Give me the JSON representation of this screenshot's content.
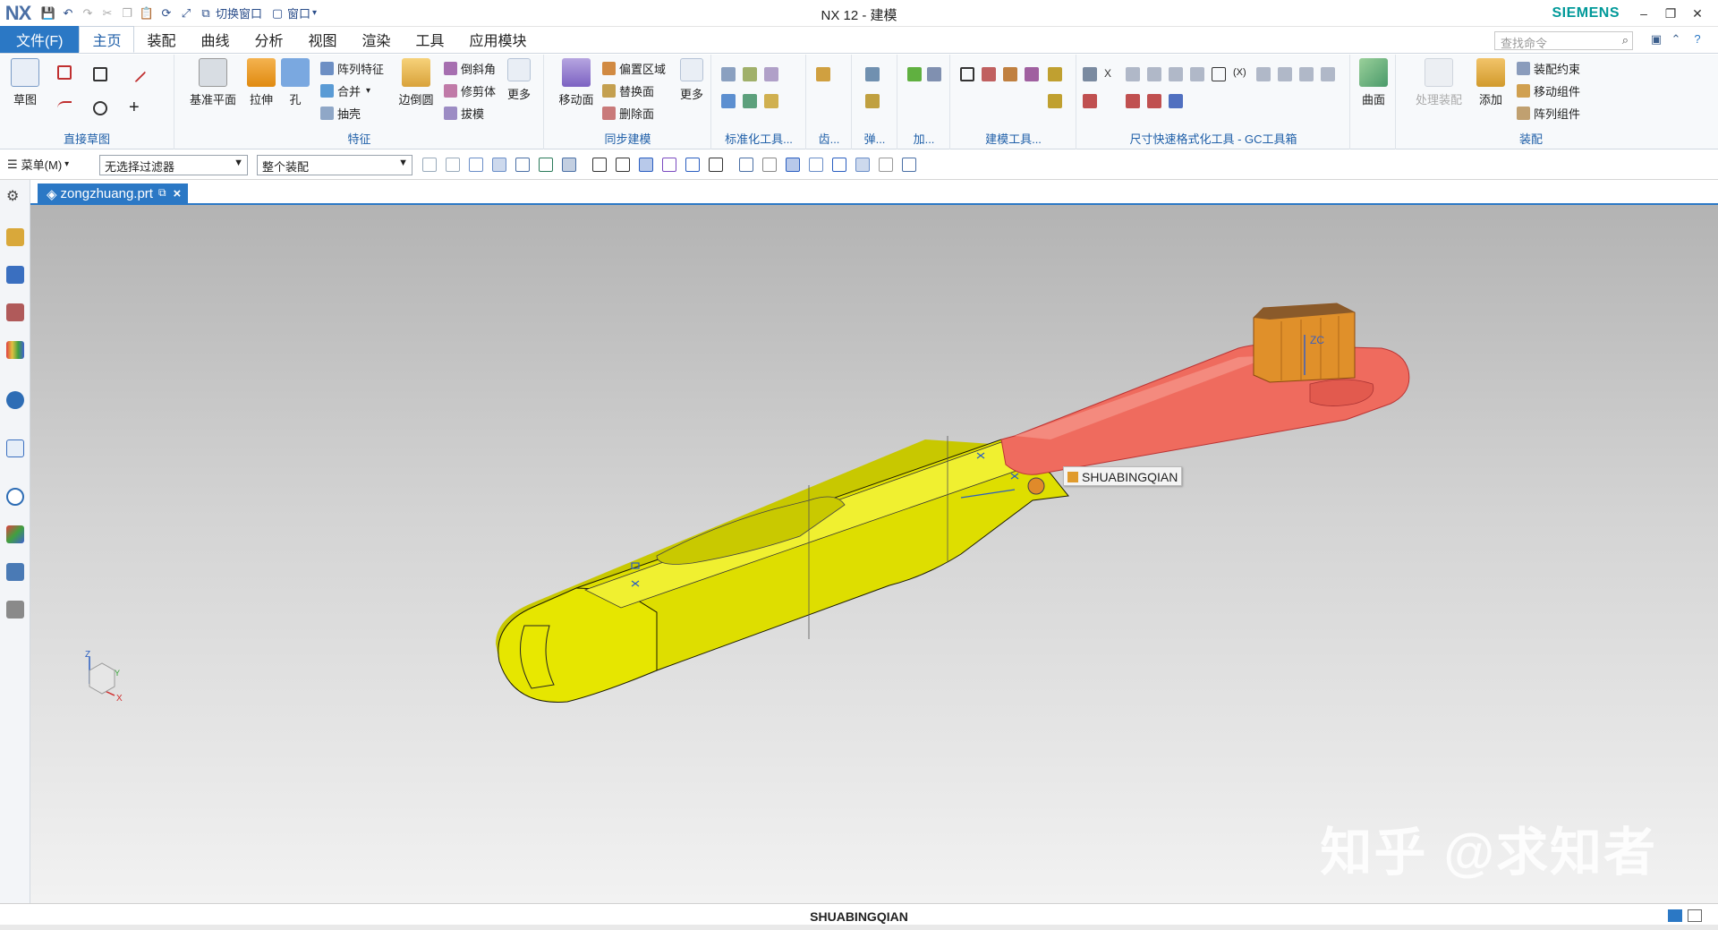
{
  "window": {
    "logo": "NX",
    "title": "NX 12 - 建模",
    "brand": "SIEMENS",
    "quick_access": {
      "switch_window": "切换窗口",
      "window_menu": "窗口"
    }
  },
  "tabs": [
    "文件(F)",
    "主页",
    "装配",
    "曲线",
    "分析",
    "视图",
    "渲染",
    "工具",
    "应用模块"
  ],
  "search": {
    "placeholder": "查找命令"
  },
  "ribbon": {
    "direct_sketch": {
      "sketch": "草图",
      "label": "直接草图"
    },
    "feature": {
      "datum_plane": "基准平面",
      "extrude": "拉伸",
      "hole": "孔",
      "pattern_feature": "阵列特征",
      "unite": "合并",
      "shell": "抽壳",
      "edge_blend": "边倒圆",
      "chamfer": "倒斜角",
      "trim_body": "修剪体",
      "draft": "拔模",
      "more": "更多",
      "label": "特征"
    },
    "sync": {
      "move_face": "移动面",
      "offset_region": "偏置区域",
      "replace_face": "替换面",
      "delete_face": "删除面",
      "more": "更多",
      "label": "同步建模"
    },
    "std_tools": {
      "label": "标准化工具..."
    },
    "gear": {
      "label": "齿..."
    },
    "spring": {
      "label": "弹..."
    },
    "add": {
      "label": "加..."
    },
    "modeling_tools": {
      "label": "建模工具..."
    },
    "gc_toolkit": {
      "label": "尺寸快速格式化工具 - GC工具箱"
    },
    "surface": {
      "surface": "曲面"
    },
    "assembly": {
      "process_assembly": "处理装配",
      "add": "添加",
      "assembly_constraint": "装配约束",
      "move_component": "移动组件",
      "pattern_component": "阵列组件",
      "label": "装配"
    }
  },
  "selbar": {
    "menu": "菜单(M)",
    "filter": "无选择过滤器",
    "scope": "整个装配"
  },
  "document": {
    "tab": "zongzhuang.prt"
  },
  "viewport": {
    "part_label": "SHUABINGQIAN",
    "watermark": "知乎 @求知者",
    "axis_z": "Z",
    "axis_x": "X",
    "axis_y": "Y",
    "zc_label": "ZC"
  },
  "status": {
    "text": "SHUABINGQIAN"
  },
  "colors": {
    "accent": "#2b78c5",
    "brand": "#009999",
    "handle": "#e2e20a",
    "head": "#ef6b5e",
    "brush": "#e0902a"
  }
}
